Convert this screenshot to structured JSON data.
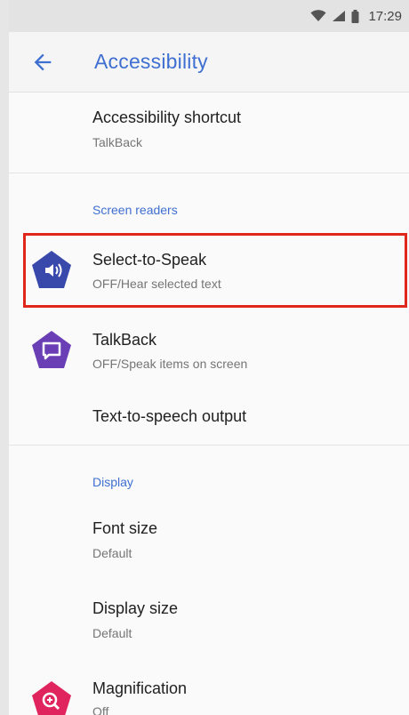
{
  "status_bar": {
    "time": "17:29",
    "icons": [
      "wifi-icon",
      "cell-signal-icon",
      "battery-icon"
    ]
  },
  "app_bar": {
    "back_icon": "arrow-back-icon",
    "title": "Accessibility"
  },
  "items": {
    "shortcut": {
      "title": "Accessibility shortcut",
      "summary": "TalkBack"
    },
    "select_to_speak": {
      "title": "Select-to-Speak",
      "summary": "OFF/Hear selected text",
      "icon": "select-to-speak-icon"
    },
    "talkback": {
      "title": "TalkBack",
      "summary": "OFF/Speak items on screen",
      "icon": "talkback-icon"
    },
    "tts": {
      "title": "Text-to-speech output"
    },
    "font_size": {
      "title": "Font size",
      "summary": "Default"
    },
    "display_size": {
      "title": "Display size",
      "summary": "Default"
    },
    "magnification": {
      "title": "Magnification",
      "summary": "Off",
      "icon": "magnification-icon"
    }
  },
  "sections": {
    "screen_readers": "Screen readers",
    "display": "Display"
  },
  "colors": {
    "accent": "#3f6fd1",
    "select_to_speak_icon": "#3949ab",
    "talkback_icon": "#6a3fb5",
    "magnification_icon": "#e0245e",
    "highlight_border": "#e0261b"
  }
}
